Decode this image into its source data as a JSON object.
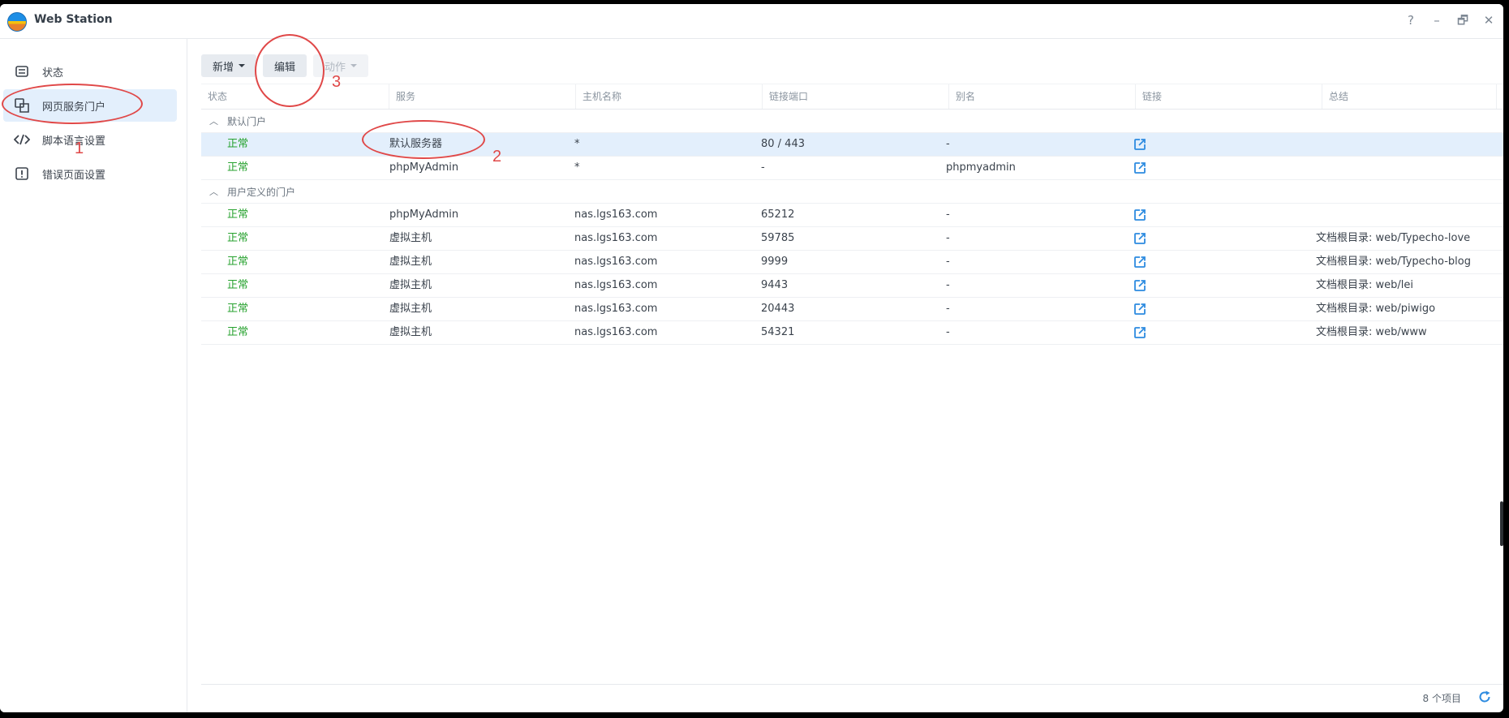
{
  "window": {
    "title": "Web Station"
  },
  "controls": {
    "help": "?",
    "minimize": "–",
    "restore": "🗗",
    "close": "✕"
  },
  "sidebar": {
    "items": [
      {
        "label": "状态",
        "icon": "status-icon"
      },
      {
        "label": "网页服务门户",
        "icon": "web-portal-icon",
        "active": true
      },
      {
        "label": "脚本语言设置",
        "icon": "code-icon"
      },
      {
        "label": "错误页面设置",
        "icon": "error-page-icon"
      }
    ]
  },
  "toolbar": {
    "create": "新增",
    "edit": "编辑",
    "action": "动作"
  },
  "table": {
    "columns": [
      "状态",
      "服务",
      "主机名称",
      "链接端口",
      "别名",
      "链接",
      "总结"
    ],
    "groups": [
      {
        "label": "默认门户",
        "rows": [
          {
            "status": "正常",
            "service": "默认服务器",
            "host": "*",
            "port": "80 / 443",
            "alias": "-",
            "summary": "",
            "selected": true
          },
          {
            "status": "正常",
            "service": "phpMyAdmin",
            "host": "*",
            "port": "-",
            "alias": "phpmyadmin",
            "summary": ""
          }
        ]
      },
      {
        "label": "用户定义的门户",
        "rows": [
          {
            "status": "正常",
            "service": "phpMyAdmin",
            "host": "nas.lgs163.com",
            "port": "65212",
            "alias": "-",
            "summary": ""
          },
          {
            "status": "正常",
            "service": "虚拟主机",
            "host": "nas.lgs163.com",
            "port": "59785",
            "alias": "-",
            "summary": "文档根目录: web/Typecho-love"
          },
          {
            "status": "正常",
            "service": "虚拟主机",
            "host": "nas.lgs163.com",
            "port": "9999",
            "alias": "-",
            "summary": "文档根目录: web/Typecho-blog"
          },
          {
            "status": "正常",
            "service": "虚拟主机",
            "host": "nas.lgs163.com",
            "port": "9443",
            "alias": "-",
            "summary": "文档根目录: web/lei"
          },
          {
            "status": "正常",
            "service": "虚拟主机",
            "host": "nas.lgs163.com",
            "port": "20443",
            "alias": "-",
            "summary": "文档根目录: web/piwigo"
          },
          {
            "status": "正常",
            "service": "虚拟主机",
            "host": "nas.lgs163.com",
            "port": "54321",
            "alias": "-",
            "summary": "文档根目录: web/www"
          }
        ]
      }
    ]
  },
  "footer": {
    "count": "8 个项目"
  },
  "annotations": {
    "one": "1",
    "two": "2",
    "three": "3"
  },
  "colors": {
    "accent": "#2d8be0",
    "status_ok": "#27a22f",
    "annotation": "#e04848"
  }
}
